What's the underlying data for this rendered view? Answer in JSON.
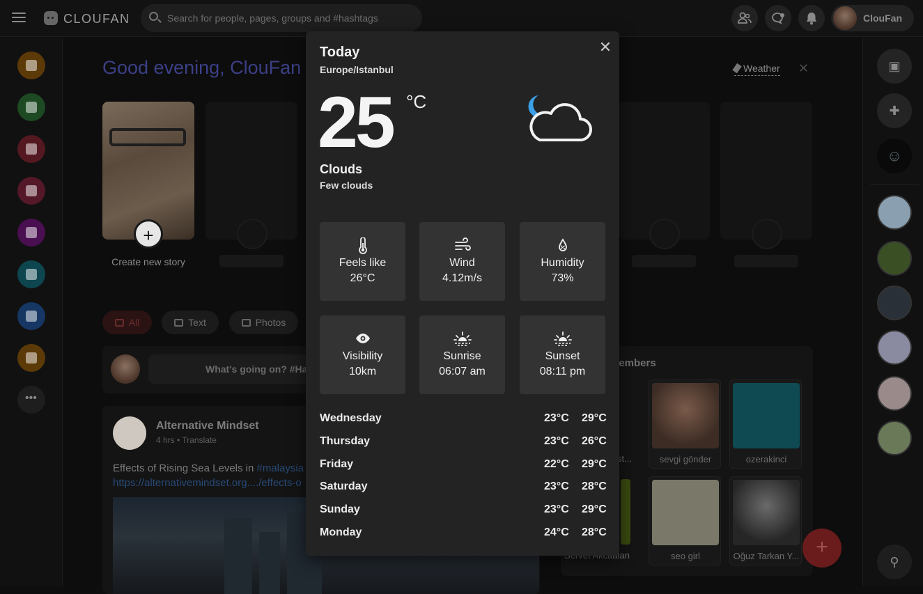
{
  "app": {
    "brand": "CLOUFAN",
    "search_placeholder": "Search for people, pages, groups and #hashtags",
    "user_name": "ClouFan"
  },
  "main": {
    "greeting": "Good evening, ClouFan",
    "weather_link": "Weather",
    "create_story": "Create new story",
    "filters": [
      "All",
      "Text",
      "Photos"
    ],
    "composer_placeholder": "What's going on? #Hashtag",
    "post": {
      "author": "Alternative Mindset",
      "time": "4 hrs",
      "translate": "Translate",
      "text_prefix": "Effects of Rising Sea Levels in ",
      "hashtag": "#malaysia",
      "link": "https://alternativemindset.org..../effects-o"
    },
    "members": {
      "title": "members",
      "cards": [
        "ost...",
        "sevgi gönder",
        "ozerakinci",
        "Servet Akcaalan",
        "seo girl",
        "Oğuz Tarkan Y..."
      ]
    }
  },
  "weather": {
    "title": "Today",
    "timezone": "Europe/Istanbul",
    "temperature": "25",
    "unit": "°C",
    "condition": "Clouds",
    "description": "Few clouds",
    "icon": "moon-cloud-icon",
    "details": [
      {
        "icon": "thermometer-icon",
        "label": "Feels like",
        "value": "26°C"
      },
      {
        "icon": "wind-icon",
        "label": "Wind",
        "value": "4.12m/s"
      },
      {
        "icon": "humidity-icon",
        "label": "Humidity",
        "value": "73%"
      },
      {
        "icon": "eye-icon",
        "label": "Visibility",
        "value": "10km"
      },
      {
        "icon": "sunrise-icon",
        "label": "Sunrise",
        "value": "06:07 am"
      },
      {
        "icon": "sunset-icon",
        "label": "Sunset",
        "value": "08:11 pm"
      }
    ],
    "forecast": [
      {
        "day": "Wednesday",
        "low": "23°C",
        "high": "29°C"
      },
      {
        "day": "Thursday",
        "low": "23°C",
        "high": "26°C"
      },
      {
        "day": "Friday",
        "low": "22°C",
        "high": "29°C"
      },
      {
        "day": "Saturday",
        "low": "23°C",
        "high": "28°C"
      },
      {
        "day": "Sunday",
        "low": "23°C",
        "high": "29°C"
      },
      {
        "day": "Monday",
        "low": "24°C",
        "high": "28°C"
      }
    ]
  },
  "colors": {
    "sidebar_icons": [
      "#f59e0b",
      "#3aa64a",
      "#e0384a",
      "#e0385c",
      "#c026d3",
      "#14b8c6",
      "#3b82f6",
      "#f59e0b"
    ],
    "modal_bg": "#232323",
    "tile_bg": "#333333"
  }
}
